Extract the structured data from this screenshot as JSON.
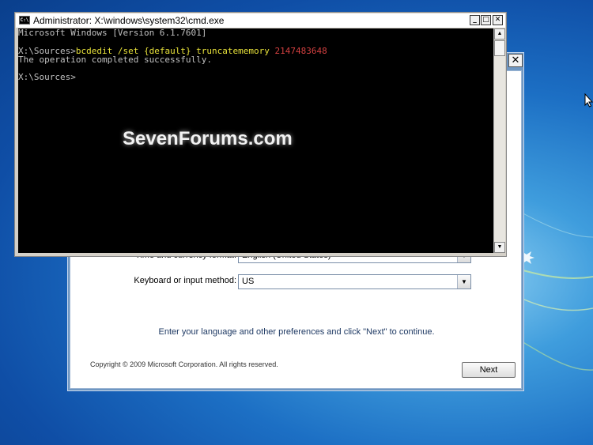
{
  "cmd": {
    "title": "Administrator: X:\\windows\\system32\\cmd.exe",
    "icon_text": "C:\\",
    "buttons": [
      "_",
      "□",
      "✕"
    ],
    "lines": [
      {
        "text": "Microsoft Windows [Version 6.1.7601]"
      },
      {
        "text": ""
      },
      {
        "prompt": "X:\\Sources>",
        "command": "bcdedit /set {default} truncatememory",
        "value": "2147483648"
      },
      {
        "text": "The operation completed successfully."
      },
      {
        "text": ""
      },
      {
        "text": "X:\\Sources>"
      }
    ],
    "watermark": "SevenForums.com"
  },
  "setup": {
    "close_label": "✕",
    "time_currency_label": "Time and currency format:",
    "time_currency_value": "English (United States)",
    "keyboard_label": "Keyboard or input method:",
    "keyboard_value": "US",
    "info": "Enter your language and other preferences and click \"Next\" to continue.",
    "copyright": "Copyright © 2009 Microsoft Corporation. All rights reserved.",
    "next_label": "Next"
  },
  "colors": {
    "console_bg": "#000000",
    "console_text": "#c0c0c0",
    "command_text": "#e8e23a",
    "value_text": "#d34040",
    "desktop_blue": "#1c6fc4"
  }
}
